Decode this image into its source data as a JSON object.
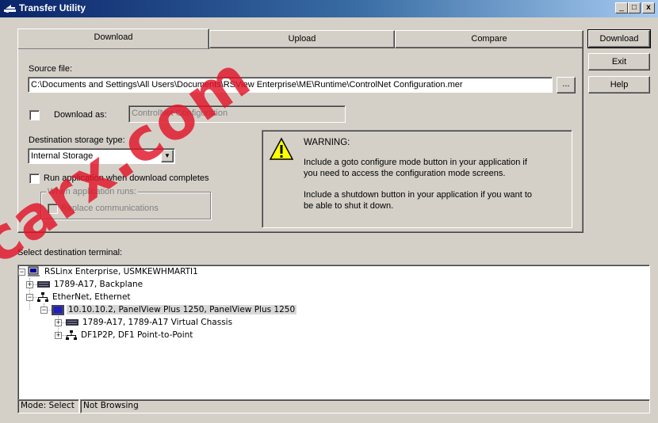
{
  "window": {
    "title": "Transfer Utility",
    "caption_buttons": [
      "_",
      "□",
      "x"
    ]
  },
  "tabs": [
    {
      "label": "Download",
      "active": true
    },
    {
      "label": "Upload",
      "active": false
    },
    {
      "label": "Compare",
      "active": false
    }
  ],
  "side_buttons": {
    "download": "Download",
    "exit": "Exit",
    "help": "Help"
  },
  "source": {
    "label": "Source file:",
    "value": "C:\\Documents and Settings\\All Users\\Documents\\RSView Enterprise\\ME\\Runtime\\ControlNet Configuration.mer",
    "browse_label": "..."
  },
  "download_as": {
    "label": "Download as:",
    "checked": false,
    "value": "ControlNet Configuration"
  },
  "storage": {
    "label": "Destination storage type:",
    "selected": "Internal Storage"
  },
  "run_app": {
    "label": "Run application when download completes",
    "checked": false
  },
  "when_runs": {
    "group_label": "When application runs:",
    "replace_label": "Replace communications"
  },
  "warning": {
    "title": "WARNING:",
    "line1": "Include a goto configure mode button in your application if",
    "line2": "you need to access the configuration mode screens.",
    "line3": "Include a shutdown button in your application if you want to",
    "line4": "be able to shut it down."
  },
  "tree": {
    "label": "Select destination terminal:",
    "nodes": [
      {
        "label": "RSLinx Enterprise, USMKEWHMARTI1",
        "icon": "computer-icon"
      },
      {
        "label": "1789-A17, Backplane",
        "icon": "backplane-icon"
      },
      {
        "label": "EtherNet, Ethernet",
        "icon": "network-icon"
      },
      {
        "label": "10.10.10.2, PanelView Plus 1250, PanelView Plus 1250",
        "icon": "panelview-icon",
        "selected": true
      },
      {
        "label": "1789-A17, 1789-A17 Virtual Chassis",
        "icon": "backplane-icon"
      },
      {
        "label": "DF1P2P, DF1 Point-to-Point",
        "icon": "network-icon"
      }
    ]
  },
  "status": {
    "mode": "Mode: Select",
    "browsing": "Not Browsing"
  },
  "watermark": "carx.com",
  "colors": {
    "titlebar_start": "#0a246a",
    "titlebar_end": "#a6caf0",
    "face": "#d4d0c8",
    "watermark": "#e21428"
  }
}
